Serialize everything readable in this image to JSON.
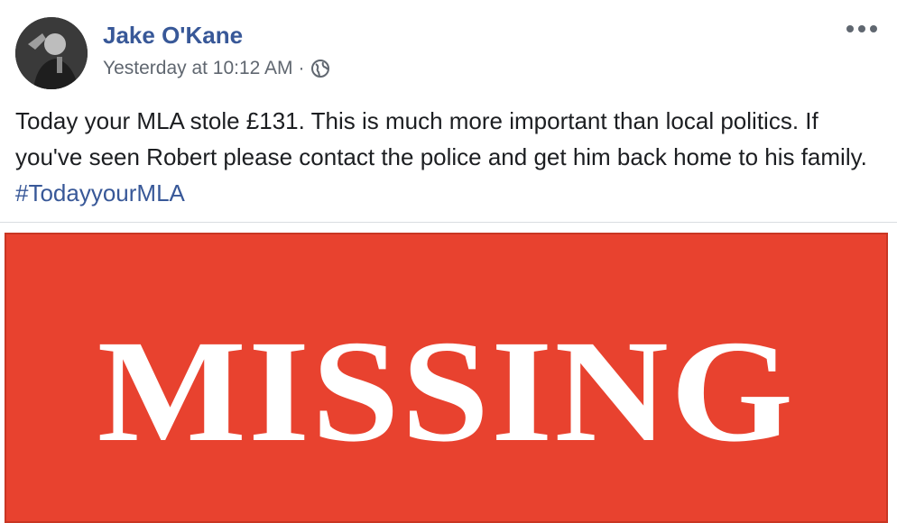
{
  "post": {
    "author": "Jake O'Kane",
    "timestamp": "Yesterday at 10:12 AM",
    "separator": "·",
    "privacy_icon": "globe-icon",
    "more_icon": "ellipsis-icon",
    "text_main": "Today your MLA stole £131. This is much more important than local politics. If you've seen Robert please contact the police and get him back home to his family. ",
    "hashtag": "#TodayyourMLA"
  },
  "image": {
    "banner_text": "MISSING"
  },
  "colors": {
    "link": "#385898",
    "meta": "#606770",
    "text": "#1c1e21",
    "banner": "#e8422f"
  }
}
